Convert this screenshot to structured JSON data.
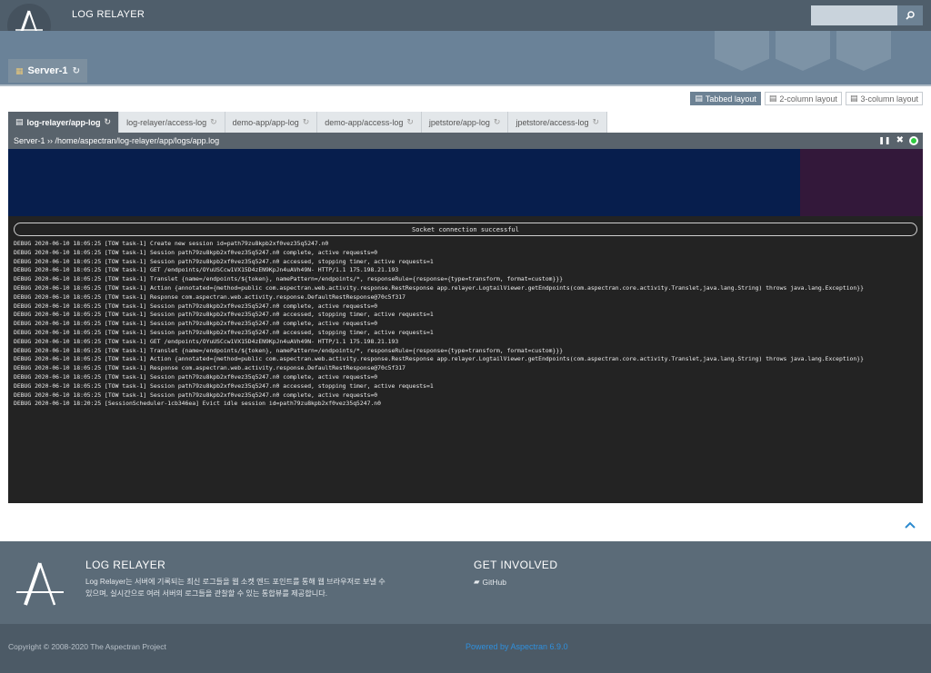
{
  "header": {
    "site_title": "LOG RELAYER",
    "search_placeholder": "",
    "server_tab": "Server-1"
  },
  "layouts": [
    {
      "label": "Tabbed layout",
      "active": true
    },
    {
      "label": "2-column layout",
      "active": false
    },
    {
      "label": "3-column layout",
      "active": false
    }
  ],
  "tabs": [
    {
      "label": "log-relayer/app-log",
      "active": true
    },
    {
      "label": "log-relayer/access-log",
      "active": false
    },
    {
      "label": "demo-app/app-log",
      "active": false
    },
    {
      "label": "demo-app/access-log",
      "active": false
    },
    {
      "label": "jpetstore/app-log",
      "active": false
    },
    {
      "label": "jpetstore/access-log",
      "active": false
    }
  ],
  "viewer": {
    "path": "Server-1 ›› /home/aspectran/log-relayer/app/logs/app.log",
    "socket_message": "Socket connection successful",
    "log_lines": [
      "DEBUG 2020-06-10 18:05:25 [TOW task-1] Create new session id=path79zu8kpb2xf0vez35q5247.n0",
      "DEBUG 2020-06-10 18:05:25 [TOW task-1] Session path79zu8kpb2xf0vez35q5247.n0 complete, active requests=0",
      "DEBUG 2020-06-10 18:05:25 [TOW task-1] Session path79zu8kpb2xf0vez35q5247.n0 accessed, stopping timer, active requests=1",
      "DEBUG 2020-06-10 18:05:25 [TOW task-1] GET /endpoints/OYuUSCcw1VX15D4zEN9KpJn4uAVh49N- HTTP/1.1 175.198.21.193",
      "DEBUG 2020-06-10 18:05:25 [TOW task-1] Translet {name=/endpoints/${token}, namePattern=/endpoints/*, responseRule={response={type=transform, format=custom}}}",
      "DEBUG 2020-06-10 18:05:25 [TOW task-1] Action {annotated={method=public com.aspectran.web.activity.response.RestResponse app.relayer.LogtailViewer.getEndpoints(com.aspectran.core.activity.Translet,java.lang.String) throws java.lang.Exception}}",
      "DEBUG 2020-06-10 18:05:25 [TOW task-1] Response com.aspectran.web.activity.response.DefaultRestResponse@70c5f317",
      "DEBUG 2020-06-10 18:05:25 [TOW task-1] Session path79zu8kpb2xf0vez35q5247.n0 complete, active requests=0",
      "DEBUG 2020-06-10 18:05:25 [TOW task-1] Session path79zu8kpb2xf0vez35q5247.n0 accessed, stopping timer, active requests=1",
      "DEBUG 2020-06-10 18:05:25 [TOW task-1] Session path79zu8kpb2xf0vez35q5247.n0 complete, active requests=0",
      "DEBUG 2020-06-10 18:05:25 [TOW task-1] Session path79zu8kpb2xf0vez35q5247.n0 accessed, stopping timer, active requests=1",
      "DEBUG 2020-06-10 18:05:25 [TOW task-1] GET /endpoints/OYuUSCcw1VX15D4zEN9KpJn4uAVh49N- HTTP/1.1 175.198.21.193",
      "DEBUG 2020-06-10 18:05:25 [TOW task-1] Translet {name=/endpoints/${token}, namePattern=/endpoints/*, responseRule={response={type=transform, format=custom}}}",
      "DEBUG 2020-06-10 18:05:25 [TOW task-1] Action {annotated={method=public com.aspectran.web.activity.response.RestResponse app.relayer.LogtailViewer.getEndpoints(com.aspectran.core.activity.Translet,java.lang.String) throws java.lang.Exception}}",
      "DEBUG 2020-06-10 18:05:25 [TOW task-1] Response com.aspectran.web.activity.response.DefaultRestResponse@70c5f317",
      "DEBUG 2020-06-10 18:05:25 [TOW task-1] Session path79zu8kpb2xf0vez35q5247.n0 complete, active requests=0",
      "DEBUG 2020-06-10 18:05:25 [TOW task-1] Session path79zu8kpb2xf0vez35q5247.n0 accessed, stopping timer, active requests=1",
      "DEBUG 2020-06-10 18:05:25 [TOW task-1] Session path79zu8kpb2xf0vez35q5247.n0 complete, active requests=0",
      "DEBUG 2020-06-10 18:20:25 [SessionScheduler-1cb346ea] Evict idle session id=path79zu8kpb2xf0vez35q5247.n0"
    ]
  },
  "footer": {
    "title": "LOG RELAYER",
    "description": "Log Relayer는 서버에 기록되는 최신 로그들을 웹 소켓 엔드 포인트를 통해 웹 브라우저로 보낼 수 있으며, 실시간으로 여러 서버의 로그들을 관찰할 수 있는 통합뷰를 제공합니다.",
    "involved_title": "GET INVOLVED",
    "github_label": "GitHub",
    "copyright": "Copyright © 2008-2020 The Aspectran Project",
    "powered_by": "Powered by Aspectran 6.9.0"
  },
  "colors": {
    "header_bg": "#5b7083",
    "active_tab": "#59636c",
    "console_bg": "#232323",
    "link_blue": "#2f8fdc",
    "status_green": "#2ecc40"
  }
}
